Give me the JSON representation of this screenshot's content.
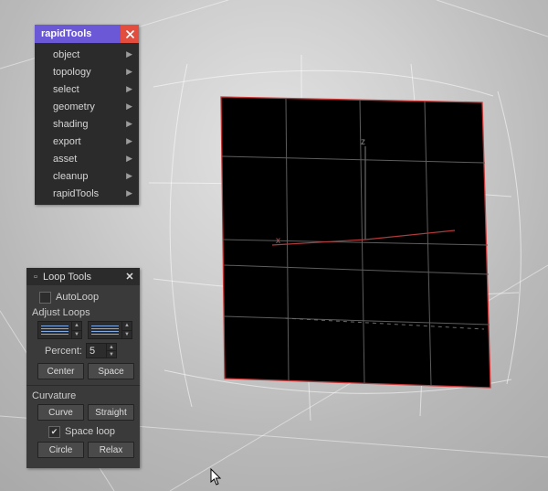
{
  "rapidMenu": {
    "title": "rapidTools",
    "items": [
      {
        "label": "object"
      },
      {
        "label": "topology"
      },
      {
        "label": "select"
      },
      {
        "label": "geometry"
      },
      {
        "label": "shading"
      },
      {
        "label": "export"
      },
      {
        "label": "asset"
      },
      {
        "label": "cleanup"
      },
      {
        "label": "rapidTools"
      }
    ],
    "arrowGlyph": "▶"
  },
  "loopTools": {
    "title": "Loop Tools",
    "toggleGlyph": "▫",
    "closeGlyph": "✕",
    "autoLoop": {
      "label": "AutoLoop",
      "checked": false
    },
    "adjustHeader": "Adjust Loops",
    "percent": {
      "label": "Percent:",
      "value": "5"
    },
    "btnCenter": "Center",
    "btnSpace": "Space",
    "curvHeader": "Curvature",
    "btnCurve": "Curve",
    "btnStraight": "Straight",
    "spaceLoop": {
      "label": "Space loop",
      "checked": true
    },
    "btnCircle": "Circle",
    "btnRelax": "Relax"
  },
  "axes": {
    "x": "x",
    "z": "z"
  }
}
